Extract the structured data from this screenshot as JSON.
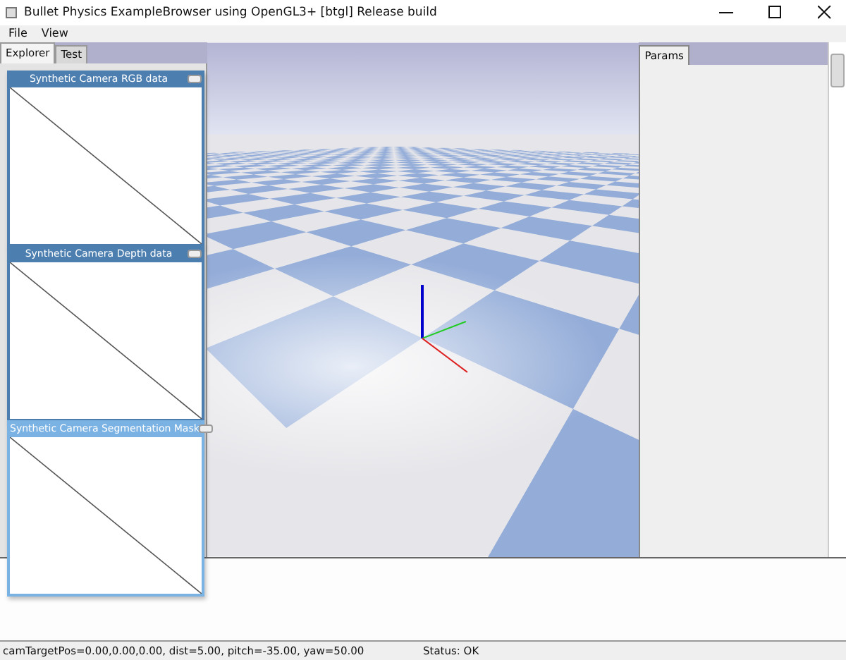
{
  "window": {
    "title": "Bullet Physics ExampleBrowser using OpenGL3+ [btgl] Release build"
  },
  "menu": [
    "File",
    "View"
  ],
  "explorer_tabs": [
    {
      "label": "Explorer",
      "selected": true
    },
    {
      "label": "Test",
      "selected": false
    }
  ],
  "camera_windows": [
    {
      "title": "Synthetic Camera RGB data",
      "selected": false
    },
    {
      "title": "Synthetic Camera Depth data",
      "selected": false
    },
    {
      "title": "Synthetic Camera Segmentation Mask",
      "selected": true
    }
  ],
  "params_panel": {
    "tab": "Params"
  },
  "status_bar": {
    "camera": "camTargetPos=0.00,0.00,0.00, dist=5.00, pitch=-35.00, yaw=50.00",
    "status": "Status: OK"
  }
}
